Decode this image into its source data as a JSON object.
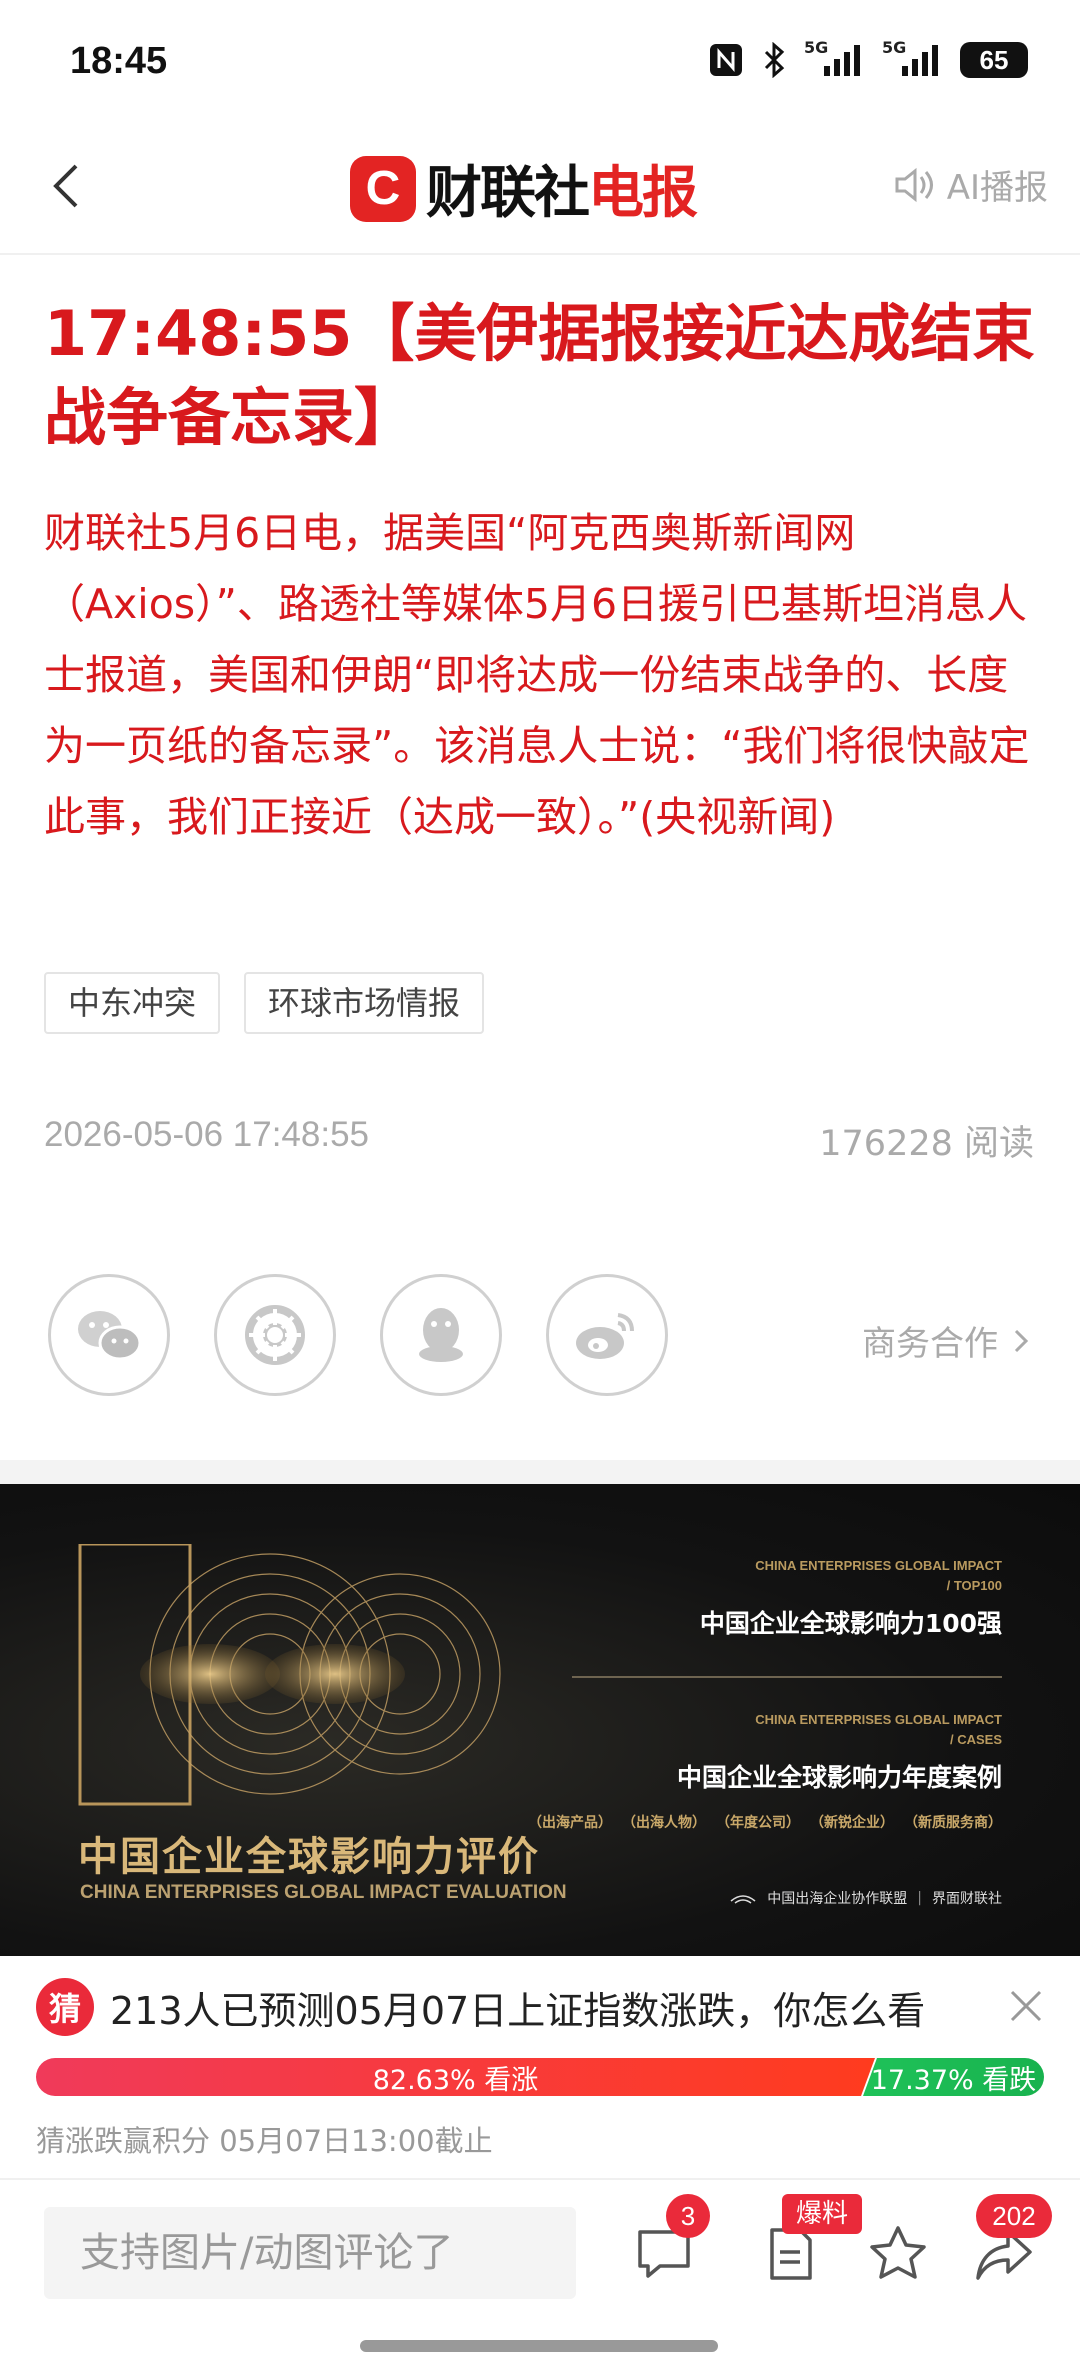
{
  "status_bar": {
    "time": "18:45",
    "battery": "65",
    "net1": "5G",
    "net2": "5G"
  },
  "nav": {
    "brand_main": "财联社",
    "brand_accent": "电报",
    "ai_label": "AI播报"
  },
  "article": {
    "headline": "17:48:55【美伊据报接近达成结束战争备忘录】",
    "body": "财联社5月6日电，据美国“阿克西奥斯新闻网（Axios）”、路透社等媒体5月6日援引巴基斯坦消息人士报道，美国和伊朗“即将达成一份结束战争的、长度为一页纸的备忘录”。该消息人士说：“我们将很快敲定此事，我们正接近（达成一致）。”(央视新闻)",
    "tags": [
      "中东冲突",
      "环球市场情报"
    ],
    "datetime": "2026-05-06 17:48:55",
    "reads": "176228 阅读"
  },
  "share": {
    "icons": [
      "wechat-icon",
      "moments-icon",
      "qq-icon",
      "weibo-icon"
    ],
    "business": "商务合作"
  },
  "banner": {
    "title": "中国企业全球影响力评价",
    "subtitle": "CHINA ENTERPRISES GLOBAL IMPACT EVALUATION",
    "block1_en1": "CHINA ENTERPRISES GLOBAL IMPACT",
    "block1_en2": "/ TOP100",
    "block1_cn": "中国企业全球影响力100强",
    "block2_en1": "CHINA ENTERPRISES GLOBAL IMPACT",
    "block2_en2": "/ CASES",
    "block2_cn": "中国企业全球影响力年度案例",
    "pills": [
      "（出海产品）",
      "（出海人物）",
      "（年度公司）",
      "（新锐企业）",
      "（新质服务商）"
    ],
    "foot_org": "中国出海企业协作联盟",
    "foot_media": "界面财联社"
  },
  "prediction": {
    "badge": "猜",
    "title": "213人已预测05月07日上证指数涨跌，你怎么看",
    "up_label": "82.63% 看涨",
    "down_label": "17.37% 看跌",
    "up_fraction": 0.8263,
    "footer": "猜涨跌赢积分  05月07日13:00截止"
  },
  "bottom": {
    "comment_placeholder": "支持图片/动图评论了",
    "comment_count": "3",
    "baoliao": "爆料",
    "share_count": "202"
  },
  "colors": {
    "accent": "#d8191d",
    "up": "#ff3b1e",
    "down": "#1fc259"
  }
}
